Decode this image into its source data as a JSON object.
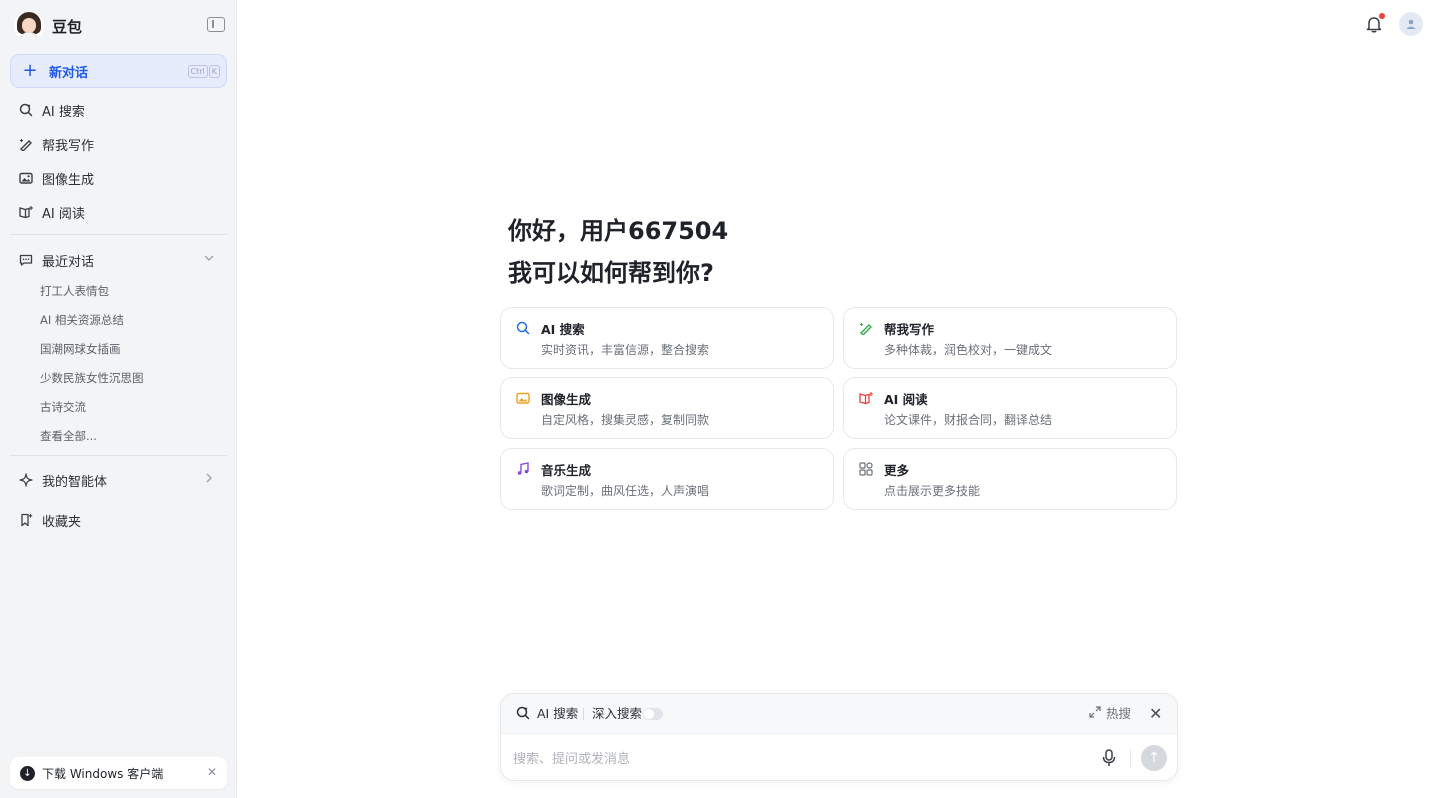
{
  "sidebar": {
    "brand": "豆包",
    "new_chat": {
      "label": "新对话",
      "kbd": [
        "Ctrl",
        "K"
      ]
    },
    "nav": [
      {
        "label": "AI 搜索"
      },
      {
        "label": "帮我写作"
      },
      {
        "label": "图像生成"
      },
      {
        "label": "AI 阅读"
      }
    ],
    "recent": {
      "label": "最近对话",
      "items": [
        "打工人表情包",
        "AI 相关资源总结",
        "国潮网球女插画",
        "少数民族女性沉思图",
        "古诗交流",
        "查看全部..."
      ]
    },
    "agents": {
      "label": "我的智能体"
    },
    "favorites": {
      "label": "收藏夹"
    },
    "download": {
      "label": "下载 Windows 客户端"
    }
  },
  "main": {
    "greeting_line1": "你好，用户667504",
    "greeting_line2": "我可以如何帮到你?",
    "cards": [
      {
        "title": "AI 搜索",
        "desc": "实时资讯，丰富信源，整合搜索",
        "icon": "search-icon",
        "color": "#1f6fe8"
      },
      {
        "title": "帮我写作",
        "desc": "多种体裁，润色校对，一键成文",
        "icon": "pen-icon",
        "color": "#2fb344"
      },
      {
        "title": "图像生成",
        "desc": "自定风格，搜集灵感，复制同款",
        "icon": "image-icon",
        "color": "#f0a020"
      },
      {
        "title": "AI 阅读",
        "desc": "论文课件，财报合同，翻译总结",
        "icon": "book-icon",
        "color": "#e8433a"
      },
      {
        "title": "音乐生成",
        "desc": "歌词定制，曲风任选，人声演唱",
        "icon": "music-icon",
        "color": "#8a4ce0"
      },
      {
        "title": "更多",
        "desc": "点击展示更多技能",
        "icon": "grid-icon",
        "color": "#6b7078"
      }
    ]
  },
  "composer": {
    "mode": "AI 搜索",
    "deep_search": "深入搜索",
    "hot": "热搜",
    "placeholder": "搜索、提问或发消息"
  }
}
